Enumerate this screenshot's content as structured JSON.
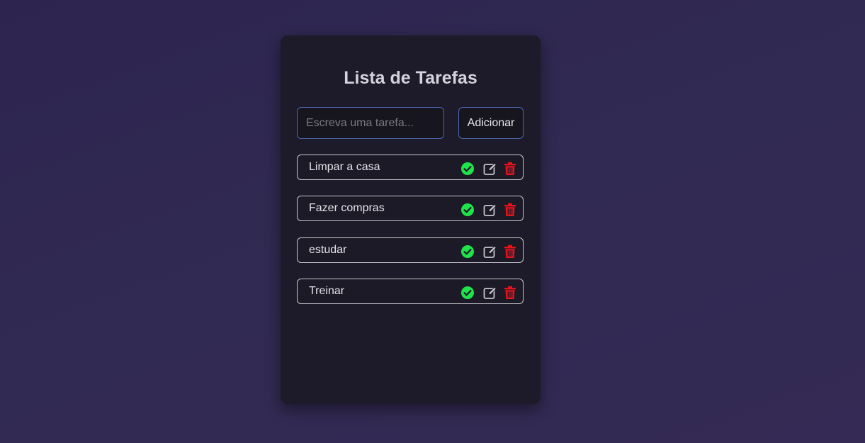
{
  "app": {
    "title": "Lista de Tarefas"
  },
  "form": {
    "input_placeholder": "Escreva uma tarefa...",
    "input_value": "",
    "add_label": "Adicionar"
  },
  "tasks": [
    {
      "label": "Limpar a casa"
    },
    {
      "label": "Fazer compras"
    },
    {
      "label": "estudar"
    },
    {
      "label": "Treinar"
    }
  ],
  "icons": {
    "complete": "check-circle-icon",
    "edit": "edit-icon",
    "delete": "trash-icon"
  },
  "colors": {
    "background": "#302852",
    "card": "#1d1b29",
    "accent_border": "#4a67b0",
    "complete": "#1ee34a",
    "delete": "#e8121b",
    "edit": "#c8c6cf"
  }
}
